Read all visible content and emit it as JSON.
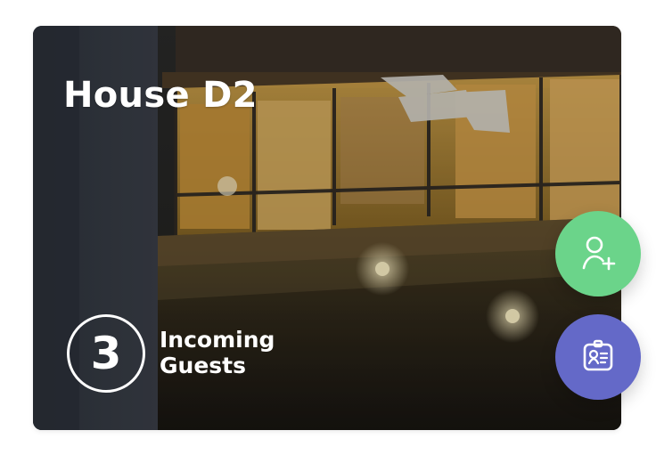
{
  "card": {
    "title": "House D2",
    "guest_count": "3",
    "guest_label_line1": "Incoming",
    "guest_label_line2": "Guests"
  },
  "actions": {
    "add_guest": {
      "icon": "user-plus-icon",
      "color": "#6bd48a"
    },
    "guest_badge": {
      "icon": "id-badge-icon",
      "color": "#6469c8"
    }
  },
  "colors": {
    "text": "#ffffff"
  }
}
